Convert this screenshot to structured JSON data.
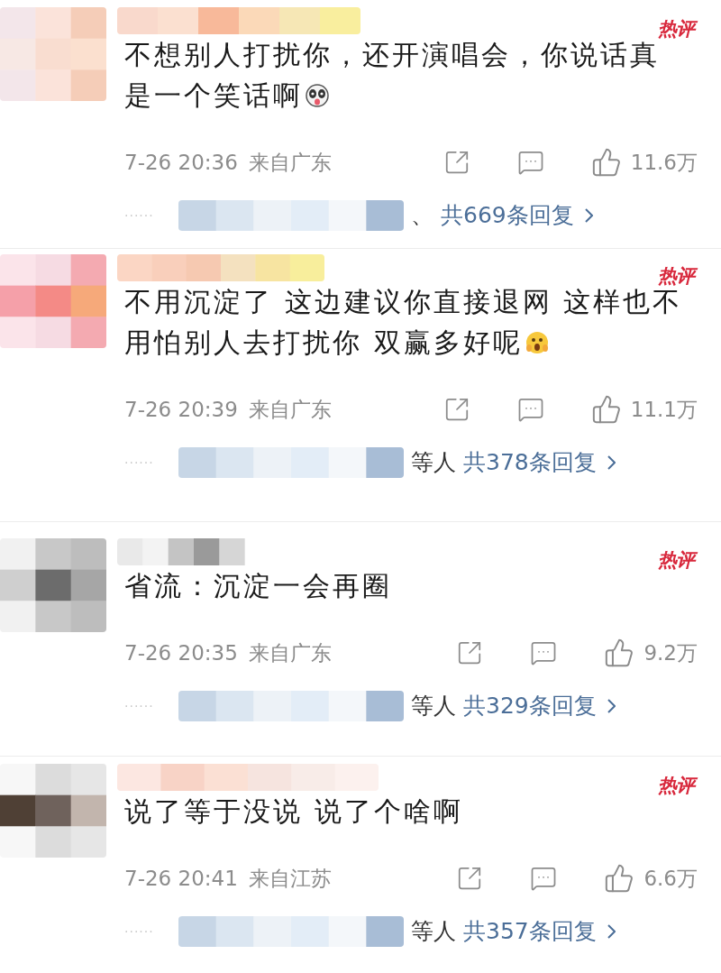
{
  "comments": [
    {
      "badge": "热评",
      "lines": [
        "不想别人打扰你，还开演唱会，你说话真",
        "是一个笑话啊"
      ],
      "emoji": {
        "kind": "panda"
      },
      "time": "7-26 20:36",
      "location": "来自广东",
      "likes": "11.6万",
      "ellipsis": "······",
      "reply_prefix": "、",
      "replies": "共669条回复"
    },
    {
      "badge": "热评",
      "lines": [
        "不用沉淀了 这边建议你直接退网 这样也不",
        "用怕别人去打扰你 双赢多好呢"
      ],
      "emoji": {
        "kind": "shocked"
      },
      "time": "7-26 20:39",
      "location": "来自广东",
      "likes": "11.1万",
      "ellipsis": "······",
      "reply_prefix": "等人",
      "replies": "共378条回复"
    },
    {
      "badge": "热评",
      "lines": [
        "省流：沉淀一会再圈"
      ],
      "time": "7-26 20:35",
      "location": "来自广东",
      "likes": "9.2万",
      "ellipsis": "······",
      "reply_prefix": "等人",
      "replies": "共329条回复"
    },
    {
      "badge": "热评",
      "lines": [
        "说了等于没说 说了个啥啊"
      ],
      "time": "7-26 20:41",
      "location": "来自江苏",
      "likes": "6.6万",
      "ellipsis": "······",
      "reply_prefix": "等人",
      "replies": "共357条回复"
    }
  ]
}
